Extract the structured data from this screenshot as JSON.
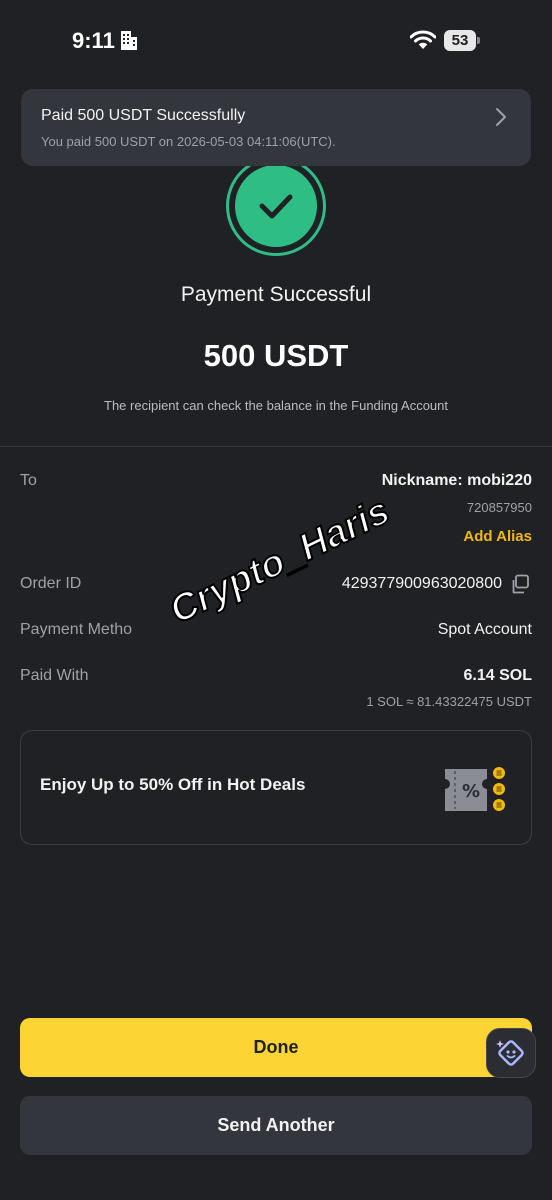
{
  "status_bar": {
    "time": "9:11",
    "battery": "53"
  },
  "notification": {
    "title": "Paid 500 USDT Successfully",
    "subtitle": "You paid 500 USDT on 2026-05-03 04:11:06(UTC)."
  },
  "result": {
    "title": "Payment Successful",
    "amount": "500 USDT",
    "note": "The recipient can check the balance in the Funding Account"
  },
  "details": {
    "to_label": "To",
    "nickname": "Nickname: mobi220",
    "user_id": "720857950",
    "add_alias": "Add Alias",
    "order_label": "Order ID",
    "order_id": "429377900963020800",
    "method_label": "Payment Metho",
    "method_value": "Spot Account",
    "paid_with_label": "Paid With",
    "paid_with_value": "6.14 SOL",
    "rate": "1 SOL ≈ 81.43322475 USDT"
  },
  "watermark": "Crypto_Haris",
  "promo": {
    "text": "Enjoy Up to 50% Off in Hot Deals"
  },
  "buttons": {
    "done": "Done",
    "send_another": "Send Another"
  },
  "colors": {
    "accent": "#fcd535",
    "success": "#2ebd85",
    "alias": "#f0b90b",
    "background": "#202124"
  }
}
